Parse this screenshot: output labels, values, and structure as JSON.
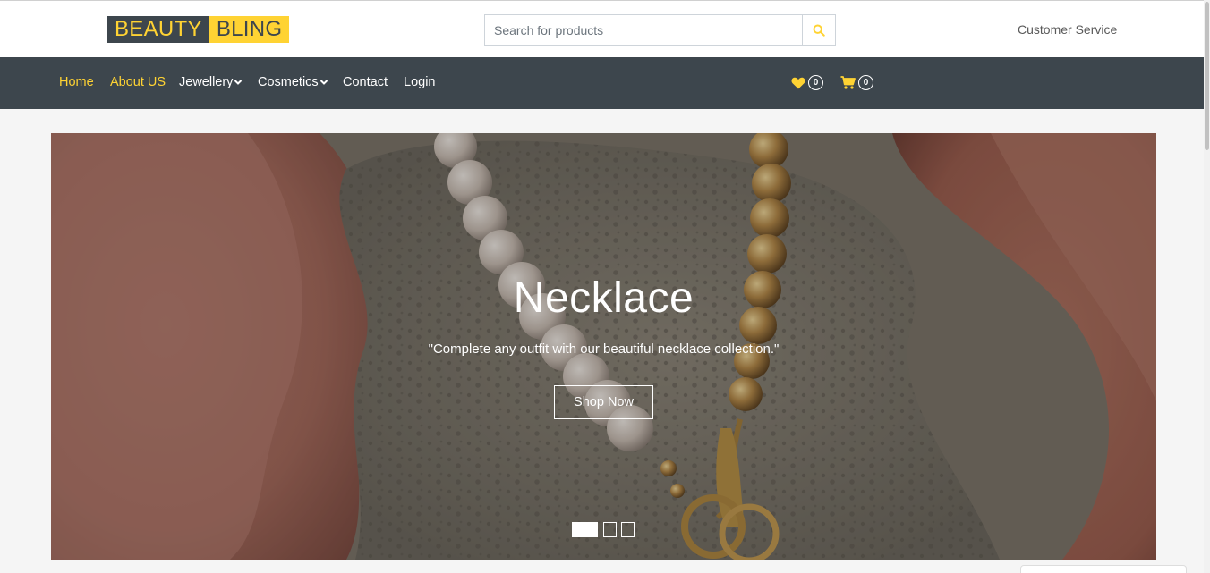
{
  "brand": {
    "part1": "BEAUTY",
    "part2": "BLING",
    "accent_color": "#ffd333",
    "dark_color": "#3d464d"
  },
  "search": {
    "placeholder": "Search for products",
    "button_icon": "search-icon"
  },
  "header": {
    "customer_service": "Customer Service"
  },
  "nav": {
    "items": [
      {
        "label": "Home",
        "active": true
      },
      {
        "label": "About US",
        "active": true
      },
      {
        "label": "Jewellery",
        "dropdown": true
      },
      {
        "label": "Cosmetics",
        "dropdown": true
      },
      {
        "label": "Contact"
      },
      {
        "label": "Login"
      }
    ],
    "wishlist": {
      "icon": "heart-icon",
      "count": "0"
    },
    "cart": {
      "icon": "shopping-cart-icon",
      "count": "0"
    }
  },
  "hero": {
    "title": "Necklace",
    "subtitle": "\"Complete any outfit with our beautiful necklace collection.\"",
    "button_label": "Shop Now",
    "slide_count": 3,
    "active_slide": 1
  }
}
